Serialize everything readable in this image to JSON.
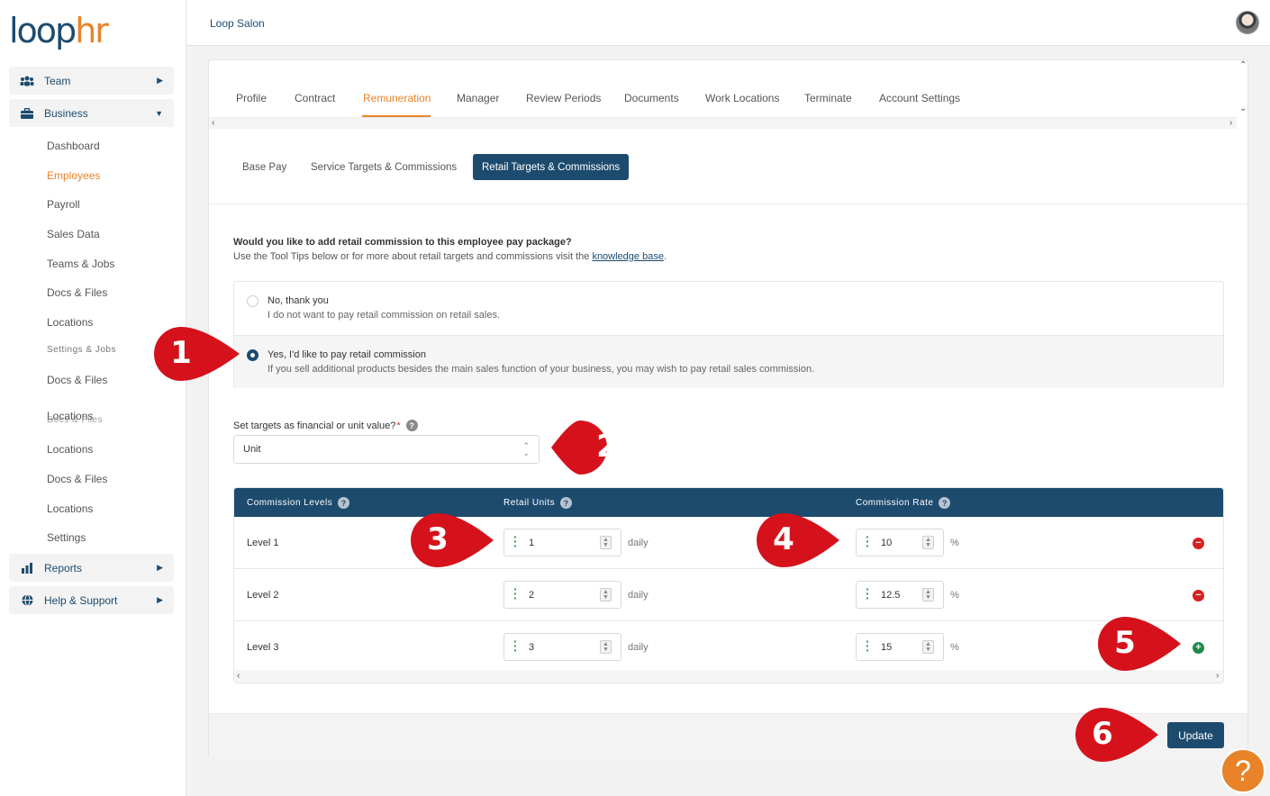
{
  "brand": {
    "logo_loop": "loop",
    "logo_hr": "hr"
  },
  "header": {
    "company": "Loop Salon"
  },
  "sidebar": {
    "groups": [
      {
        "label": "Team",
        "icon": "team-icon",
        "arrow": "▶"
      },
      {
        "label": "Business",
        "icon": "briefcase-icon",
        "arrow": "▼"
      },
      {
        "label": "Reports",
        "icon": "bar-chart-icon",
        "arrow": "▶"
      },
      {
        "label": "Help & Support",
        "icon": "globe-icon",
        "arrow": "▶"
      }
    ],
    "business_items": [
      "Dashboard",
      "Employees",
      "Payroll",
      "Sales Data",
      "Teams & Jobs",
      "Docs & Files",
      "Locations"
    ],
    "overlap_items": [
      "Settings & Jobs",
      "Docs & Files",
      "Locations",
      "Docs & Files",
      "Locations",
      "Docs & Files",
      "Locations",
      "Settings"
    ]
  },
  "tabs": [
    "Profile",
    "Contract",
    "Remuneration",
    "Manager",
    "Review Periods",
    "Documents",
    "Work Locations",
    "Terminate",
    "Account Settings"
  ],
  "subtabs": [
    "Base Pay",
    "Service Targets & Commissions",
    "Retail Targets & Commissions"
  ],
  "question": {
    "title": "Would you like to add retail commission to this employee pay package?",
    "sub_prefix": "Use the Tool Tips below or for more about retail targets and commissions visit the",
    "link": "knowledge base",
    "sub_suffix": "."
  },
  "options": [
    {
      "label": "No, thank you",
      "desc": "I do not want to pay retail commission on retail sales.",
      "selected": false
    },
    {
      "label": "Yes, I'd like to pay retail commission",
      "desc": "If you sell additional products besides the main sales function of your business, you may wish to pay retail sales commission.",
      "selected": true
    }
  ],
  "target_type": {
    "label": "Set targets as financial or unit value?",
    "required": "*",
    "help": "?",
    "value": "Unit"
  },
  "table": {
    "headers": [
      "Commission Levels",
      "Retail Units",
      "Commission Rate"
    ],
    "rows": [
      {
        "level": "Level 1",
        "units": "1",
        "unit_suffix": "daily",
        "rate": "10",
        "rate_suffix": "%",
        "action": "remove"
      },
      {
        "level": "Level 2",
        "units": "2",
        "unit_suffix": "daily",
        "rate": "12.5",
        "rate_suffix": "%",
        "action": "remove"
      },
      {
        "level": "Level 3",
        "units": "3",
        "unit_suffix": "daily",
        "rate": "15",
        "rate_suffix": "%",
        "action": "add"
      }
    ]
  },
  "update_label": "Update",
  "annotations": [
    "1",
    "2",
    "3",
    "4",
    "5",
    "6"
  ],
  "help_fab": "?",
  "colors": {
    "brand_navy": "#1d4b6e",
    "accent_orange": "#e8832a",
    "marker_red": "#d5121b",
    "add_green": "#1e8a4a"
  }
}
